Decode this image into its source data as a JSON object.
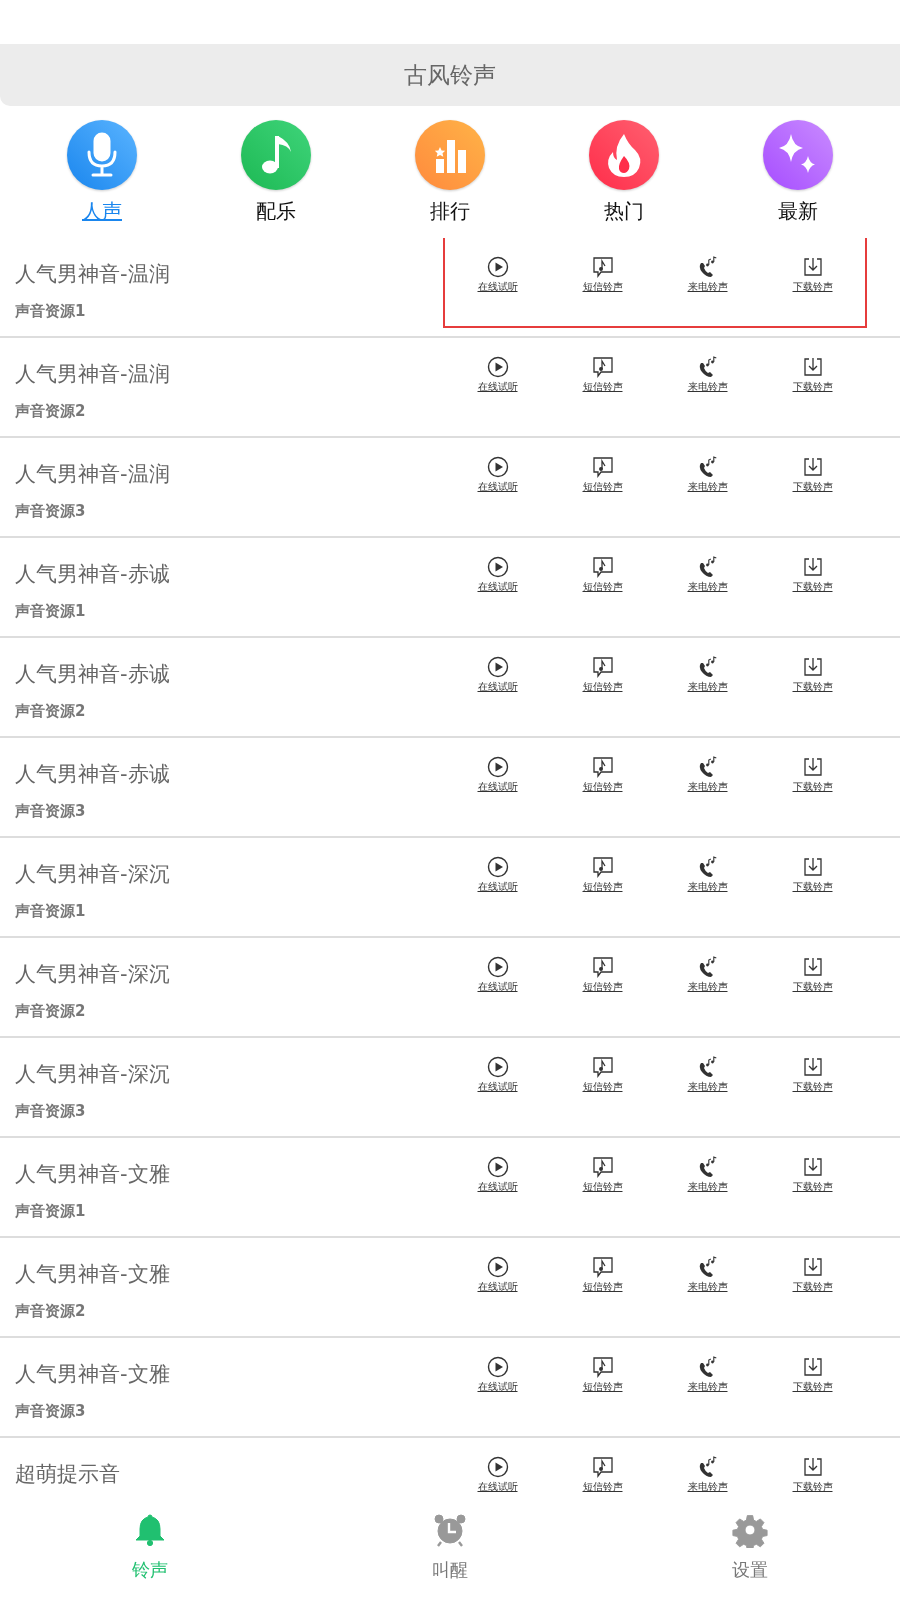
{
  "header": {
    "title": "古风铃声"
  },
  "categories": [
    {
      "kind": "mic",
      "label": "人声",
      "selected": true
    },
    {
      "kind": "music",
      "label": "配乐",
      "selected": false
    },
    {
      "kind": "chart",
      "label": "排行",
      "selected": false
    },
    {
      "kind": "fire",
      "label": "热门",
      "selected": false
    },
    {
      "kind": "sparkle",
      "label": "最新",
      "selected": false
    }
  ],
  "rows": [
    {
      "title": "人气男神音-温润",
      "subtitle": "声音资源1",
      "highlighted": true,
      "actions": [
        {
          "kind": "play",
          "label": "在线试听"
        },
        {
          "kind": "sms",
          "label": "短信铃声"
        },
        {
          "kind": "call",
          "label": "来电铃声"
        },
        {
          "kind": "download",
          "label": "下载铃声"
        }
      ]
    },
    {
      "title": "人气男神音-温润",
      "subtitle": "声音资源2",
      "highlighted": false,
      "actions": [
        {
          "kind": "play",
          "label": "在线试听"
        },
        {
          "kind": "sms",
          "label": "短信铃声"
        },
        {
          "kind": "call",
          "label": "来电铃声"
        },
        {
          "kind": "download",
          "label": "下载铃声"
        }
      ]
    },
    {
      "title": "人气男神音-温润",
      "subtitle": "声音资源3",
      "highlighted": false,
      "actions": [
        {
          "kind": "play",
          "label": "在线试听"
        },
        {
          "kind": "sms",
          "label": "短信铃声"
        },
        {
          "kind": "call",
          "label": "来电铃声"
        },
        {
          "kind": "download",
          "label": "下载铃声"
        }
      ]
    },
    {
      "title": "人气男神音-赤诚",
      "subtitle": "声音资源1",
      "highlighted": false,
      "actions": [
        {
          "kind": "play",
          "label": "在线试听"
        },
        {
          "kind": "sms",
          "label": "短信铃声"
        },
        {
          "kind": "call",
          "label": "来电铃声"
        },
        {
          "kind": "download",
          "label": "下载铃声"
        }
      ]
    },
    {
      "title": "人气男神音-赤诚",
      "subtitle": "声音资源2",
      "highlighted": false,
      "actions": [
        {
          "kind": "play",
          "label": "在线试听"
        },
        {
          "kind": "sms",
          "label": "短信铃声"
        },
        {
          "kind": "call",
          "label": "来电铃声"
        },
        {
          "kind": "download",
          "label": "下载铃声"
        }
      ]
    },
    {
      "title": "人气男神音-赤诚",
      "subtitle": "声音资源3",
      "highlighted": false,
      "actions": [
        {
          "kind": "play",
          "label": "在线试听"
        },
        {
          "kind": "sms",
          "label": "短信铃声"
        },
        {
          "kind": "call",
          "label": "来电铃声"
        },
        {
          "kind": "download",
          "label": "下载铃声"
        }
      ]
    },
    {
      "title": "人气男神音-深沉",
      "subtitle": "声音资源1",
      "highlighted": false,
      "actions": [
        {
          "kind": "play",
          "label": "在线试听"
        },
        {
          "kind": "sms",
          "label": "短信铃声"
        },
        {
          "kind": "call",
          "label": "来电铃声"
        },
        {
          "kind": "download",
          "label": "下载铃声"
        }
      ]
    },
    {
      "title": "人气男神音-深沉",
      "subtitle": "声音资源2",
      "highlighted": false,
      "actions": [
        {
          "kind": "play",
          "label": "在线试听"
        },
        {
          "kind": "sms",
          "label": "短信铃声"
        },
        {
          "kind": "call",
          "label": "来电铃声"
        },
        {
          "kind": "download",
          "label": "下载铃声"
        }
      ]
    },
    {
      "title": "人气男神音-深沉",
      "subtitle": "声音资源3",
      "highlighted": false,
      "actions": [
        {
          "kind": "play",
          "label": "在线试听"
        },
        {
          "kind": "sms",
          "label": "短信铃声"
        },
        {
          "kind": "call",
          "label": "来电铃声"
        },
        {
          "kind": "download",
          "label": "下载铃声"
        }
      ]
    },
    {
      "title": "人气男神音-文雅",
      "subtitle": "声音资源1",
      "highlighted": false,
      "actions": [
        {
          "kind": "play",
          "label": "在线试听"
        },
        {
          "kind": "sms",
          "label": "短信铃声"
        },
        {
          "kind": "call",
          "label": "来电铃声"
        },
        {
          "kind": "download",
          "label": "下载铃声"
        }
      ]
    },
    {
      "title": "人气男神音-文雅",
      "subtitle": "声音资源2",
      "highlighted": false,
      "actions": [
        {
          "kind": "play",
          "label": "在线试听"
        },
        {
          "kind": "sms",
          "label": "短信铃声"
        },
        {
          "kind": "call",
          "label": "来电铃声"
        },
        {
          "kind": "download",
          "label": "下载铃声"
        }
      ]
    },
    {
      "title": "人气男神音-文雅",
      "subtitle": "声音资源3",
      "highlighted": false,
      "actions": [
        {
          "kind": "play",
          "label": "在线试听"
        },
        {
          "kind": "sms",
          "label": "短信铃声"
        },
        {
          "kind": "call",
          "label": "来电铃声"
        },
        {
          "kind": "download",
          "label": "下载铃声"
        }
      ]
    },
    {
      "title": "超萌提示音",
      "highlighted": false,
      "actions": [
        {
          "kind": "play",
          "label": "在线试听"
        },
        {
          "kind": "sms",
          "label": "短信铃声"
        },
        {
          "kind": "call",
          "label": "来电铃声"
        },
        {
          "kind": "download",
          "label": "下载铃声"
        }
      ]
    }
  ],
  "bottom_nav": [
    {
      "kind": "bell",
      "label": "铃声",
      "selected": true
    },
    {
      "kind": "alarm",
      "label": "叫醒",
      "selected": false
    },
    {
      "kind": "gear",
      "label": "设置",
      "selected": false
    }
  ]
}
